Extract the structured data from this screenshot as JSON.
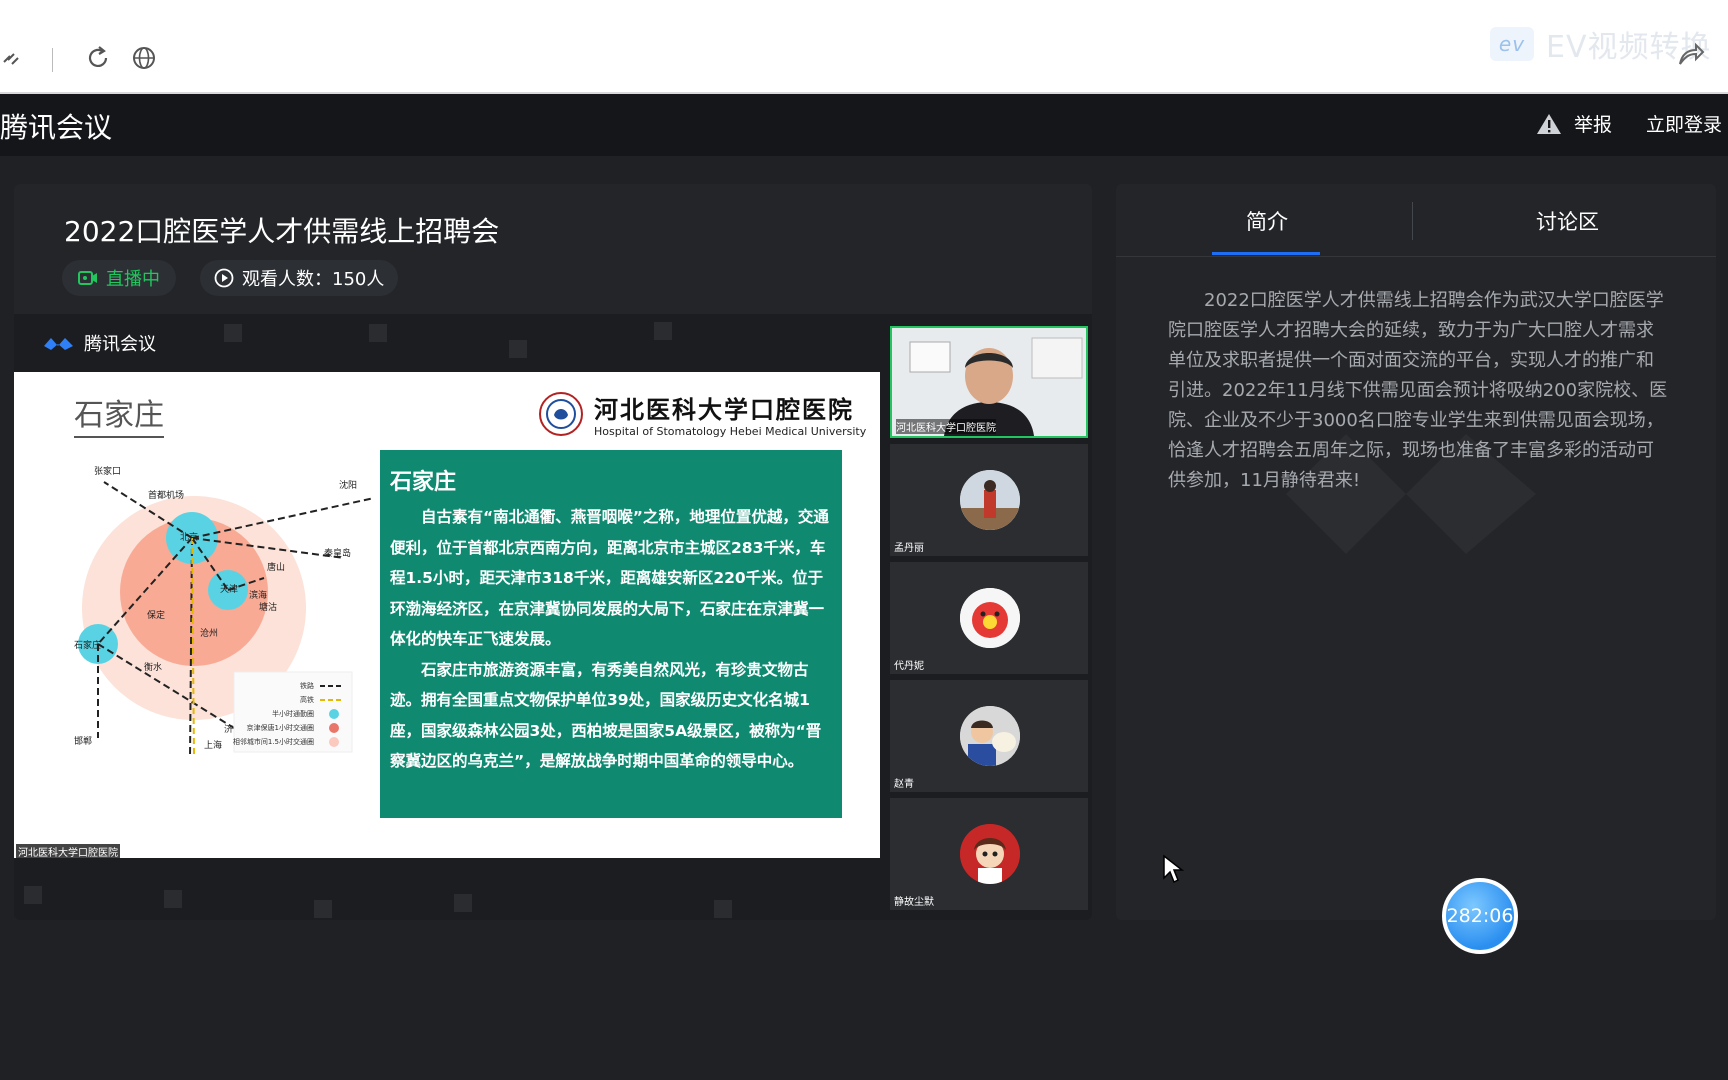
{
  "browser": {
    "watermark": "EV视频转换"
  },
  "appbar": {
    "title": "腾讯会议",
    "report_label": "举报",
    "login_label": "立即登录"
  },
  "event": {
    "title": "2022口腔医学人才供需线上招聘会",
    "live_label": "直播中",
    "viewers_label": "观看人数：150人"
  },
  "video": {
    "logo_text": "腾讯会议",
    "slide": {
      "city_heading": "石家庄",
      "hospital_name_cn": "河北医科大学口腔医院",
      "hospital_name_en": "Hospital of Stomatology Hebei Medical University",
      "box_title": "石家庄",
      "paragraphs": [
        "自古素有“南北通衢、燕晋咽喉”之称，地理位置优越，交通便利，位于首都北京西南方向，距离北京市主城区283千米，车程1.5小时，距天津市318千米，距离雄安新区220千米。位于环渤海经济区，在京津冀协同发展的大局下，石家庄在京津冀一体化的快车正飞速发展。",
        "石家庄市旅游资源丰富，有秀美自然风光，有珍贵文物古迹。拥有全国重点文物保护单位39处，国家级历史文化名城1座，国家级森林公园3处，西柏坡是国家5A级景区，被称为“晋察冀边区的乌克兰”，是解放战争时期中国革命的领导中心。"
      ],
      "footer": "河北医科大学口腔医院",
      "map": {
        "cities": [
          "张家口",
          "首都机场",
          "沈阳",
          "北京",
          "秦皇岛",
          "唐山",
          "天津",
          "滨海",
          "塘沽",
          "保定",
          "石家庄",
          "衡水",
          "沧州",
          "邯郸",
          "济南",
          "上海"
        ],
        "legend": [
          "铁路",
          "高铁",
          "半小时通勤圈",
          "京津保唐1小时交通圈",
          "相邻城市间1.5小时交通圈"
        ]
      }
    },
    "participants": [
      {
        "name": "河北医科大学口腔医院"
      },
      {
        "name": "孟丹丽"
      },
      {
        "name": "代丹妮"
      },
      {
        "name": "赵青"
      },
      {
        "name": "静故尘默"
      }
    ]
  },
  "side": {
    "tabs": [
      "简介",
      "讨论区"
    ],
    "intro": "2022口腔医学人才供需线上招聘会作为武汉大学口腔医学院口腔医学人才招聘大会的延续，致力于为广大口腔人才需求单位及求职者提供一个面对面交流的平台，实现人才的推广和引进。2022年11月线下供需见面会预计将吸纳200家院校、医院、企业及不少于3000名口腔专业学生来到供需见面会现场，恰逢人才招聘会五周年之际，现场也准备了丰富多彩的活动可供参加，11月静待君来!"
  },
  "timer": {
    "value": "282:06"
  }
}
